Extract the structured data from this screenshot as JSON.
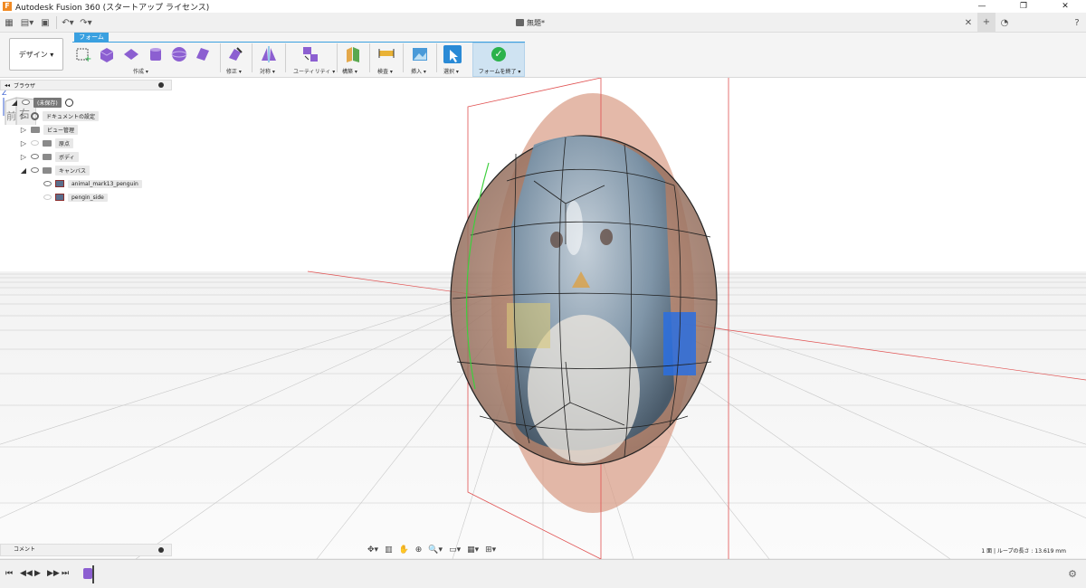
{
  "window": {
    "title": "Autodesk Fusion 360 (スタートアップ ライセンス)",
    "controls": [
      "—",
      "❐",
      "✕"
    ]
  },
  "document": {
    "tab_title": "無題*"
  },
  "ribbon": {
    "workspace_label": "デザイン ▾",
    "active_tab": "フォーム",
    "groups": {
      "create": "作成 ▾",
      "modify": "修正 ▾",
      "symmetry": "対称 ▾",
      "utility": "ユーティリティ ▾",
      "construct": "構築 ▾",
      "inspect": "検査 ▾",
      "insert": "挿入 ▾",
      "select": "選択 ▾",
      "finish": "フォームを終了 ▾"
    }
  },
  "browser": {
    "title": "ブラウザ",
    "root": "(未保存)",
    "items": [
      {
        "label": "ドキュメントの設定",
        "icon": "gear-icon"
      },
      {
        "label": "ビュー管理",
        "icon": "folder-icon"
      },
      {
        "label": "原点",
        "icon": "folder-icon"
      },
      {
        "label": "ボディ",
        "icon": "folder-icon"
      },
      {
        "label": "キャンバス",
        "icon": "folder-icon"
      }
    ],
    "canvases": [
      {
        "label": "animal_mark13_penguin"
      },
      {
        "label": "pengin_side"
      }
    ]
  },
  "comments": {
    "label": "コメント"
  },
  "status": {
    "text": "1 面 | ループの長さ : 13.619 mm"
  },
  "viewcube": {
    "front": "前",
    "right": "右",
    "axis": "Z"
  },
  "colors": {
    "accent": "#3aa0e0",
    "finish_bg": "#cfe3f2",
    "check": "#2bb24c",
    "body": "#6f8da6",
    "canvas_side": "#d89b85",
    "timeline_marker": "#8c5fd1"
  }
}
